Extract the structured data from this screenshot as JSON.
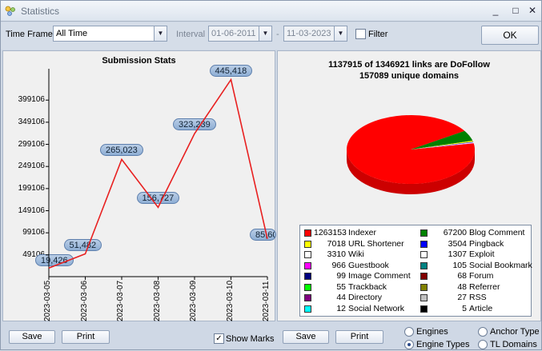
{
  "window": {
    "title": "Statistics",
    "minimize": "_",
    "maximize": "□",
    "close": "✕"
  },
  "toolbar": {
    "time_frame_label": "Time Frame",
    "time_frame_value": "All Time",
    "interval_label": "Interval",
    "date_from": "01-06-2011",
    "date_to": "11-03-2023",
    "separator": "-",
    "filter_label": "Filter",
    "ok_label": "OK"
  },
  "left_panel": {
    "save": "Save",
    "print": "Print",
    "show_marks": "Show Marks",
    "show_marks_checked": true
  },
  "chart_data": [
    {
      "type": "line",
      "title": "Submission Stats",
      "x": [
        "2023-03-05",
        "2023-03-06",
        "2023-03-07",
        "2023-03-08",
        "2023-03-09",
        "2023-03-10",
        "2023-03-11"
      ],
      "series": [
        {
          "values": [
            19426,
            51482,
            265023,
            156727,
            323239,
            445418,
            85600
          ],
          "color": "#e82020"
        }
      ],
      "data_labels": [
        "19,426",
        "51,482",
        "265,023",
        "156,727",
        "323,239",
        "445,418",
        "85,60"
      ],
      "yticks": [
        49106,
        99106,
        149106,
        199106,
        249106,
        299106,
        349106,
        399106
      ],
      "ytick_labels": [
        "49106",
        "99106",
        "149106",
        "199106",
        "249106",
        "299106",
        "349106",
        "399106"
      ],
      "ylim": [
        0,
        470000
      ],
      "grid": false
    },
    {
      "type": "pie",
      "title": "1137915 of 1346921 links are DoFollow",
      "subtitle": "157089 unique domains",
      "legend_placement": "bottom",
      "slices": [
        {
          "label": "Indexer",
          "value": 1263153,
          "color": "#ff0000"
        },
        {
          "label": "URL Shortener",
          "value": 7018,
          "color": "#ffff00"
        },
        {
          "label": "Wiki",
          "value": 3310,
          "color": "#ffffff"
        },
        {
          "label": "Guestbook",
          "value": 966,
          "color": "#ff00ff"
        },
        {
          "label": "Image Comment",
          "value": 99,
          "color": "#000080"
        },
        {
          "label": "Trackback",
          "value": 55,
          "color": "#00ff00"
        },
        {
          "label": "Directory",
          "value": 44,
          "color": "#800080"
        },
        {
          "label": "Social Network",
          "value": 12,
          "color": "#00ffff"
        },
        {
          "label": "Blog Comment",
          "value": 67200,
          "color": "#008000"
        },
        {
          "label": "Pingback",
          "value": 3504,
          "color": "#0000ff"
        },
        {
          "label": "Exploit",
          "value": 1307,
          "color": "#ffffff"
        },
        {
          "label": "Social Bookmark",
          "value": 105,
          "color": "#008080"
        },
        {
          "label": "Forum",
          "value": 68,
          "color": "#800000"
        },
        {
          "label": "Referrer",
          "value": 48,
          "color": "#808000"
        },
        {
          "label": "RSS",
          "value": 27,
          "color": "#c0c0c0"
        },
        {
          "label": "Article",
          "value": 5,
          "color": "#000000"
        }
      ]
    }
  ],
  "right_panel": {
    "save": "Save",
    "print": "Print",
    "options": [
      {
        "label": "Engines",
        "selected": false
      },
      {
        "label": "Anchor Type",
        "selected": false
      },
      {
        "label": "Engine Types",
        "selected": true
      },
      {
        "label": "TL Domains",
        "selected": false
      }
    ]
  }
}
